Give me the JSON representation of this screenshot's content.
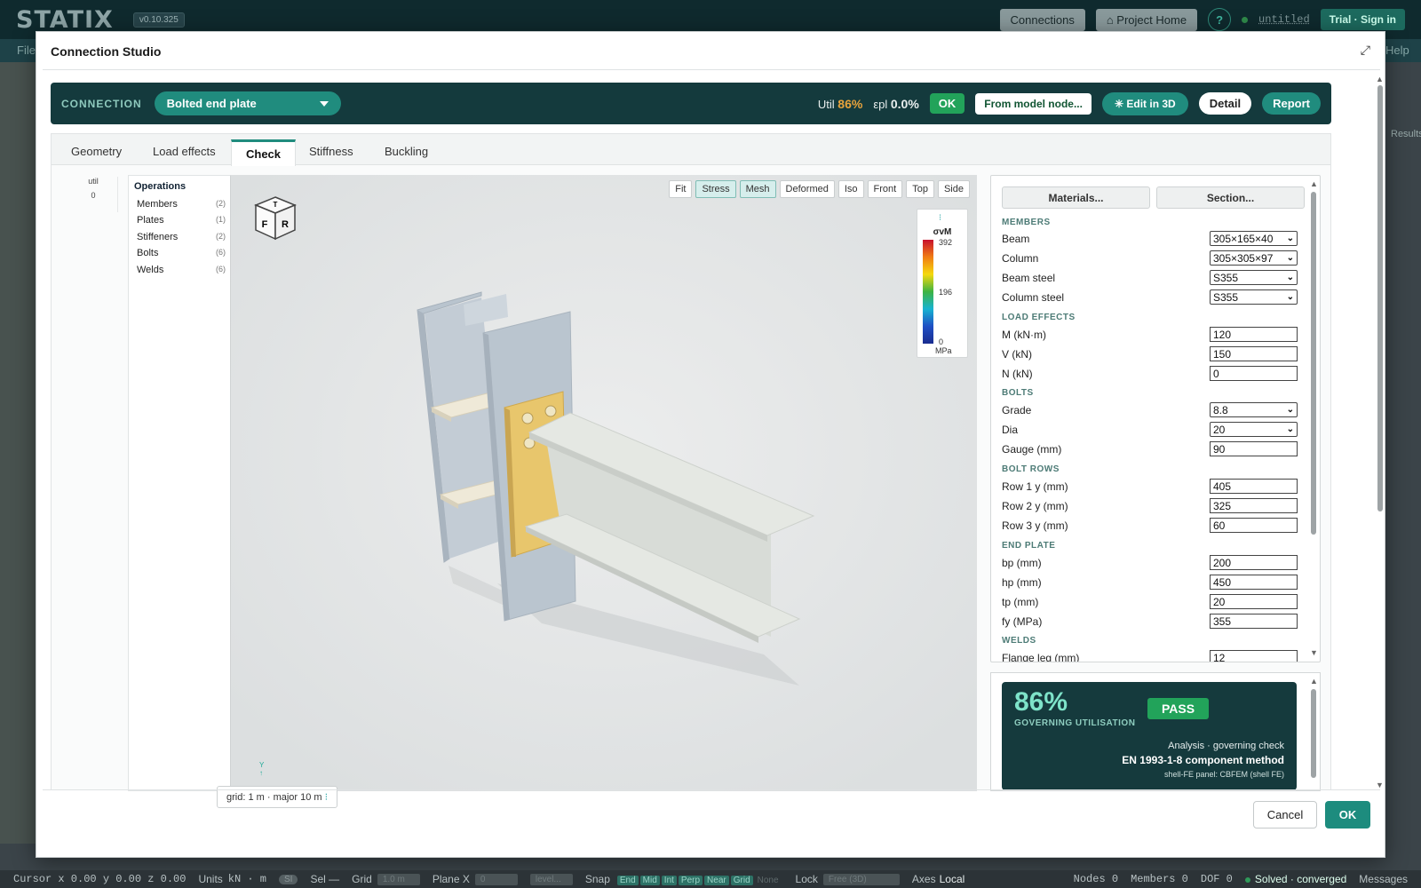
{
  "app": {
    "logo": "STATIX",
    "version": "v0.10.325",
    "connections_btn": "Connections",
    "project_home_btn": "Project Home",
    "help_label": "?",
    "file_name": "untitled",
    "trial_btn": "Trial · Sign in",
    "bg_menu_file": "File",
    "bg_menu_help": "Help",
    "bg_results": "Results"
  },
  "modal": {
    "title": "Connection Studio",
    "cancel_label": "Cancel",
    "ok_label": "OK"
  },
  "connection": {
    "label": "CONNECTION",
    "type": "Bolted end plate",
    "util_label": "Util",
    "util_value": "86%",
    "epl_label": "εpl",
    "epl_value": "0.0%",
    "status": "OK",
    "from_model_btn": "From model node...",
    "edit3d_btn": "Edit in 3D",
    "detail_btn": "Detail",
    "report_btn": "Report"
  },
  "tabs": [
    "Geometry",
    "Load effects",
    "Check",
    "Stiffness",
    "Buckling"
  ],
  "active_tab": "Check",
  "util_column": {
    "label": "util",
    "value": "0"
  },
  "operations": {
    "title": "Operations",
    "items": [
      {
        "label": "Members",
        "count": "(2)"
      },
      {
        "label": "Plates",
        "count": "(1)"
      },
      {
        "label": "Stiffeners",
        "count": "(2)"
      },
      {
        "label": "Bolts",
        "count": "(6)"
      },
      {
        "label": "Welds",
        "count": "(6)"
      }
    ]
  },
  "viewport": {
    "tools": [
      "Fit",
      "Stress",
      "Mesh",
      "Deformed",
      "Iso",
      "Front",
      "Top",
      "Side"
    ],
    "active_tools": [
      "Stress",
      "Mesh"
    ],
    "view_cube": {
      "top": "T",
      "front": "F",
      "right": "R"
    },
    "legend": {
      "title": "σvM",
      "max": "392",
      "mid": "196",
      "min": "0",
      "unit": "MPa"
    },
    "grid_label": "grid: 1 m · major 10 m",
    "axis_y": "Y",
    "colors": {
      "column": "#b7c2cd",
      "beam": "#dfe3de",
      "plate": "#e8c66c",
      "stiffener": "#ede6d3"
    }
  },
  "properties": {
    "materials_btn": "Materials...",
    "section_btn": "Section...",
    "sections": [
      {
        "title": "MEMBERS",
        "rows": [
          {
            "label": "Beam",
            "type": "select",
            "value": "305×165×40"
          },
          {
            "label": "Column",
            "type": "select",
            "value": "305×305×97"
          },
          {
            "label": "Beam steel",
            "type": "select",
            "value": "S355"
          },
          {
            "label": "Column steel",
            "type": "select",
            "value": "S355"
          }
        ]
      },
      {
        "title": "LOAD EFFECTS",
        "rows": [
          {
            "label": "M (kN·m)",
            "type": "input",
            "value": "120"
          },
          {
            "label": "V (kN)",
            "type": "input",
            "value": "150"
          },
          {
            "label": "N (kN)",
            "type": "input",
            "value": "0"
          }
        ]
      },
      {
        "title": "BOLTS",
        "rows": [
          {
            "label": "Grade",
            "type": "select",
            "value": "8.8"
          },
          {
            "label": "Dia",
            "type": "select",
            "value": "20"
          },
          {
            "label": "Gauge (mm)",
            "type": "input",
            "value": "90"
          }
        ]
      },
      {
        "title": "BOLT ROWS",
        "rows": [
          {
            "label": "Row 1 y (mm)",
            "type": "input",
            "value": "405"
          },
          {
            "label": "Row 2 y (mm)",
            "type": "input",
            "value": "325"
          },
          {
            "label": "Row 3 y (mm)",
            "type": "input",
            "value": "60"
          }
        ]
      },
      {
        "title": "END PLATE",
        "rows": [
          {
            "label": "bp (mm)",
            "type": "input",
            "value": "200"
          },
          {
            "label": "hp (mm)",
            "type": "input",
            "value": "450"
          },
          {
            "label": "tp (mm)",
            "type": "input",
            "value": "20"
          },
          {
            "label": "fy (MPa)",
            "type": "input",
            "value": "355"
          }
        ]
      },
      {
        "title": "WELDS",
        "rows": [
          {
            "label": "Flange leg (mm)",
            "type": "input",
            "value": "12"
          }
        ]
      }
    ]
  },
  "result": {
    "utilisation": "86%",
    "label": "GOVERNING UTILISATION",
    "status": "PASS",
    "line1": "Analysis · governing check",
    "line2": "EN 1993-1-8 component method",
    "line3": "shell-FE panel: CBFEM (shell FE)"
  },
  "statusbar": {
    "cursor": "Cursor x 0.00 y 0.00 z 0.00",
    "units_label": "Units",
    "units_value": "kN · m",
    "si": "SI",
    "sel": "Sel —",
    "grid_label": "Grid",
    "grid_value": "1.0 m",
    "plane_label": "Plane X",
    "plane_value": "0",
    "level_value": "level...",
    "snap_label": "Snap",
    "snaps": [
      "End",
      "Mid",
      "Int",
      "Perp",
      "Near",
      "Grid"
    ],
    "snap_none": "None",
    "lock_label": "Lock",
    "lock_value": "Free (3D)",
    "axes_label": "Axes",
    "axes_value": "Local",
    "nodes": "Nodes 0",
    "members": "Members 0",
    "dof": "DOF 0",
    "solved": "Solved · converged",
    "messages": "Messages"
  }
}
